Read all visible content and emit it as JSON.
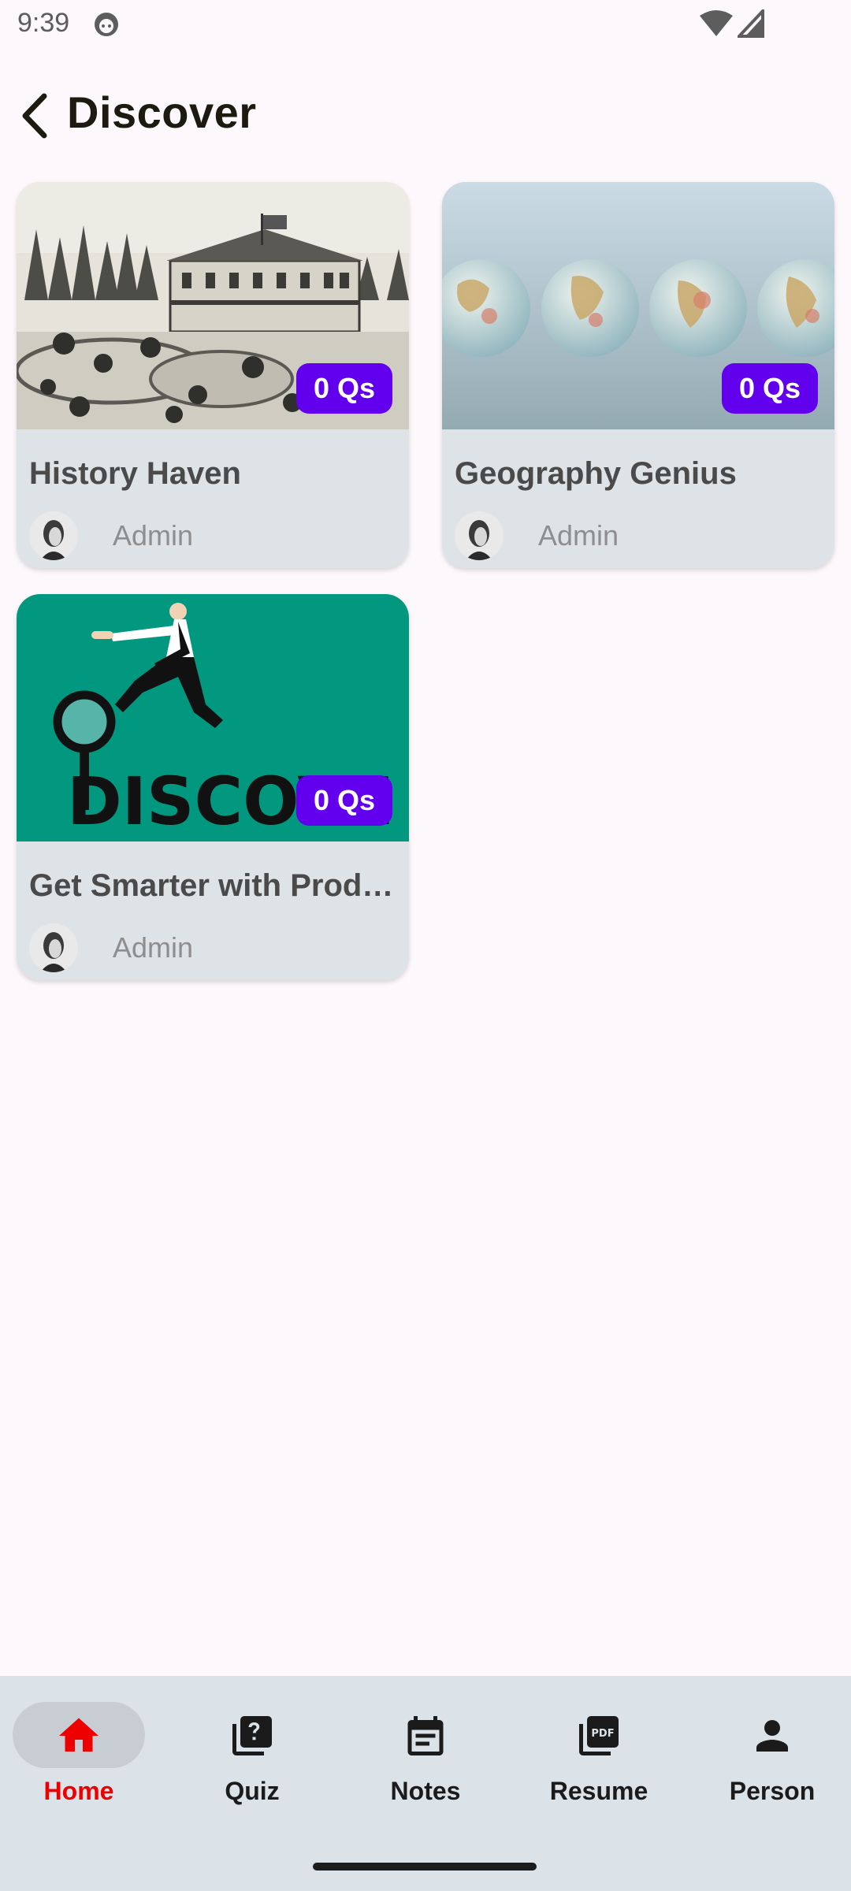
{
  "status_bar": {
    "time": "9:39"
  },
  "header": {
    "title": "Discover"
  },
  "cards": [
    {
      "title": "History Haven",
      "qs": "0 Qs",
      "author": "Admin",
      "thumb": "engraving-estate-illustration"
    },
    {
      "title": "Geography Genius",
      "qs": "0 Qs",
      "author": "Admin",
      "thumb": "row-of-globes-photo"
    },
    {
      "title": "Get Smarter with Prod…",
      "qs": "0 Qs",
      "author": "Admin",
      "thumb": "discover-magnifier-illustration",
      "thumb_text": "DISCOVE"
    }
  ],
  "bottom_nav": {
    "items": [
      {
        "label": "Home",
        "icon": "home-icon",
        "active": true
      },
      {
        "label": "Quiz",
        "icon": "quiz-icon"
      },
      {
        "label": "Notes",
        "icon": "notes-icon"
      },
      {
        "label": "Resume",
        "icon": "pdf-icon"
      },
      {
        "label": "Person",
        "icon": "person-icon"
      }
    ]
  },
  "colors": {
    "accent": "#6200ee",
    "active_nav": "#ef0000",
    "background": "#fdf8fb",
    "card": "#dde3e7",
    "nav_bar": "#dbe3e8"
  }
}
